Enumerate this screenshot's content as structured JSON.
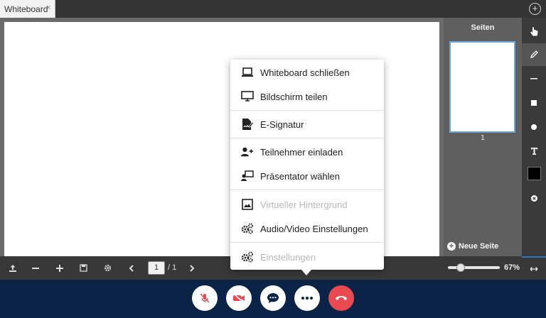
{
  "tabs": [
    {
      "label": "Whiteboard",
      "close": "×"
    }
  ],
  "tab_add": "+",
  "pages_panel": {
    "title": "Seiten",
    "page_number": "1",
    "new_page_label": "Neue Seite"
  },
  "page_nav": {
    "current": "1",
    "total": "/ 1"
  },
  "zoom": {
    "label": "67%",
    "fraction": 0.25
  },
  "menu": {
    "items": [
      {
        "label": "Whiteboard schließen",
        "icon": "laptop-icon",
        "disabled": false
      },
      {
        "label": "Bildschirm teilen",
        "icon": "monitor-icon",
        "disabled": false
      },
      {
        "label": "E-Signatur",
        "icon": "signature-icon",
        "disabled": false
      },
      {
        "label": "Teilnehmer einladen",
        "icon": "add-user-icon",
        "disabled": false
      },
      {
        "label": "Präsentator wählen",
        "icon": "presenter-icon",
        "disabled": false
      },
      {
        "label": "Virtueller Hintergrund",
        "icon": "image-icon",
        "disabled": true
      },
      {
        "label": "Audio/Video Einstellungen",
        "icon": "gears-icon",
        "disabled": false
      },
      {
        "label": "Einstellungen",
        "icon": "gears-icon",
        "disabled": true
      }
    ]
  },
  "colors": {
    "call_bar": "#0b2346",
    "hangup": "#e84a4f",
    "accent": "#2f74c8",
    "active_color": "#000000"
  }
}
